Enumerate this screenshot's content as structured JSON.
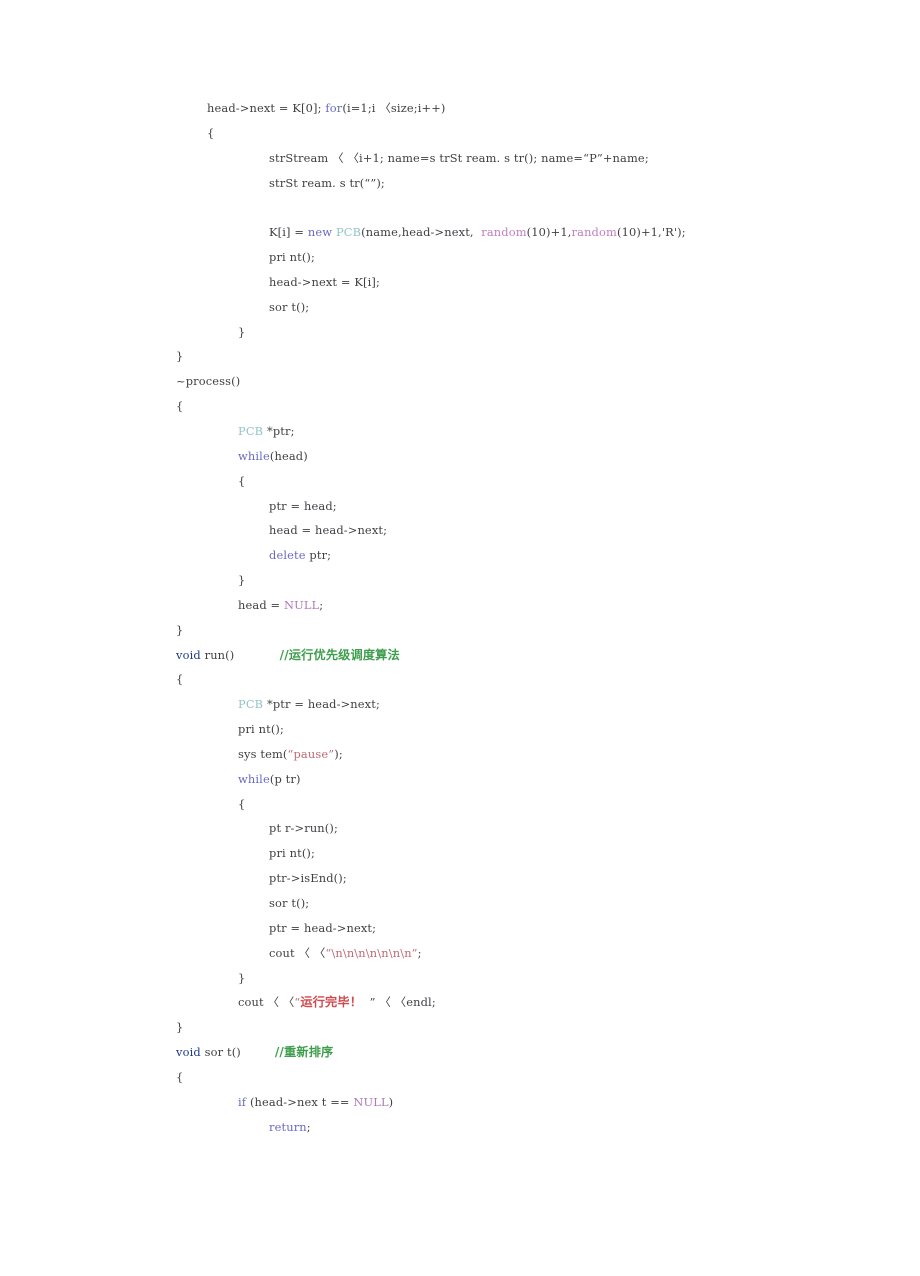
{
  "document": {
    "kind": "printed-source-code-page",
    "language": "C++",
    "background_color": "#ffffff",
    "default_text_color": "#3f3f44"
  },
  "colors": {
    "plain": "#3f3f44",
    "keyword": "#6a6ac4",
    "type": "#1e3a8a",
    "class_name": "#93c4c8",
    "function": "#c07ec0",
    "constant": "#b07ab8",
    "string": "#c06a74",
    "string_cn": "#d04a50",
    "comment": "#3f9e4d"
  },
  "code": {
    "lines": [
      {
        "indent": 0,
        "tokens": [
          {
            "t": "head->next = K[0]; ",
            "c": "plain"
          },
          {
            "t": "for",
            "c": "keyword"
          },
          {
            "t": "(i=1;i ",
            "c": "plain"
          },
          {
            "t": "〈",
            "c": "plain"
          },
          {
            "t": "size;i++)",
            "c": "plain"
          }
        ]
      },
      {
        "indent": 0,
        "tokens": [
          {
            "t": "{",
            "c": "plain"
          }
        ]
      },
      {
        "indent": 2,
        "tokens": [
          {
            "t": "strStream ",
            "c": "plain"
          },
          {
            "t": "〈 〈",
            "c": "plain"
          },
          {
            "t": "i+1; name=s trSt ream. s tr(); name=",
            "c": "plain"
          },
          {
            "t": "“P”",
            "c": "plain"
          },
          {
            "t": "+name;",
            "c": "plain"
          }
        ]
      },
      {
        "indent": 2,
        "tokens": [
          {
            "t": "strSt ream. s tr(",
            "c": "plain"
          },
          {
            "t": "“”",
            "c": "plain"
          },
          {
            "t": ");",
            "c": "plain"
          }
        ]
      },
      {
        "indent": 0,
        "tokens": []
      },
      {
        "indent": 2,
        "tokens": [
          {
            "t": "K[i] = ",
            "c": "plain"
          },
          {
            "t": "new",
            "c": "keyword"
          },
          {
            "t": " ",
            "c": "plain"
          },
          {
            "t": "PCB",
            "c": "class_name"
          },
          {
            "t": "(name,head->next,  ",
            "c": "plain"
          },
          {
            "t": "random",
            "c": "function"
          },
          {
            "t": "(10)+1,",
            "c": "plain"
          },
          {
            "t": "random",
            "c": "function"
          },
          {
            "t": "(10)+1,'R');",
            "c": "plain"
          }
        ]
      },
      {
        "indent": 2,
        "tokens": [
          {
            "t": "pri nt();",
            "c": "plain"
          }
        ]
      },
      {
        "indent": 2,
        "tokens": [
          {
            "t": "head->next = K[i];",
            "c": "plain"
          }
        ]
      },
      {
        "indent": 2,
        "tokens": [
          {
            "t": "sor t();",
            "c": "plain"
          }
        ]
      },
      {
        "indent": 1,
        "tokens": [
          {
            "t": "}",
            "c": "plain"
          }
        ]
      },
      {
        "indent": -1,
        "tokens": [
          {
            "t": "}",
            "c": "plain"
          }
        ]
      },
      {
        "indent": -1,
        "tokens": [
          {
            "t": "~process()",
            "c": "plain"
          }
        ]
      },
      {
        "indent": -1,
        "tokens": [
          {
            "t": "{",
            "c": "plain"
          }
        ]
      },
      {
        "indent": 1,
        "tokens": [
          {
            "t": "PCB",
            "c": "class_name"
          },
          {
            "t": " *ptr;",
            "c": "plain"
          }
        ]
      },
      {
        "indent": 1,
        "tokens": [
          {
            "t": "while",
            "c": "keyword"
          },
          {
            "t": "(head)",
            "c": "plain"
          }
        ]
      },
      {
        "indent": 1,
        "tokens": [
          {
            "t": "{",
            "c": "plain"
          }
        ]
      },
      {
        "indent": 2,
        "tokens": [
          {
            "t": "ptr = head;",
            "c": "plain"
          }
        ]
      },
      {
        "indent": 2,
        "tokens": [
          {
            "t": "head = head->next;",
            "c": "plain"
          }
        ]
      },
      {
        "indent": 2,
        "tokens": [
          {
            "t": "delete",
            "c": "keyword"
          },
          {
            "t": " ptr;",
            "c": "plain"
          }
        ]
      },
      {
        "indent": 1,
        "tokens": [
          {
            "t": "}",
            "c": "plain"
          }
        ]
      },
      {
        "indent": 1,
        "tokens": [
          {
            "t": "head = ",
            "c": "plain"
          },
          {
            "t": "NULL",
            "c": "constant"
          },
          {
            "t": ";",
            "c": "plain"
          }
        ]
      },
      {
        "indent": -1,
        "tokens": [
          {
            "t": "}",
            "c": "plain"
          }
        ]
      },
      {
        "indent": -1,
        "tokens": [
          {
            "t": "void",
            "c": "type"
          },
          {
            "t": " run()            ",
            "c": "plain"
          },
          {
            "t": "//运行优先级调度算法",
            "c": "comment",
            "cn": true
          }
        ]
      },
      {
        "indent": -1,
        "tokens": [
          {
            "t": "{",
            "c": "plain"
          }
        ]
      },
      {
        "indent": 1,
        "tokens": [
          {
            "t": "PCB",
            "c": "class_name"
          },
          {
            "t": " *ptr = head->next;",
            "c": "plain"
          }
        ]
      },
      {
        "indent": 1,
        "tokens": [
          {
            "t": "pri nt();",
            "c": "plain"
          }
        ]
      },
      {
        "indent": 1,
        "tokens": [
          {
            "t": "sys tem(",
            "c": "plain"
          },
          {
            "t": "“pause”",
            "c": "string"
          },
          {
            "t": ");",
            "c": "plain"
          }
        ]
      },
      {
        "indent": 1,
        "tokens": [
          {
            "t": "while",
            "c": "keyword"
          },
          {
            "t": "(p tr)",
            "c": "plain"
          }
        ]
      },
      {
        "indent": 1,
        "tokens": [
          {
            "t": "{",
            "c": "plain"
          }
        ]
      },
      {
        "indent": 2,
        "tokens": [
          {
            "t": "pt r->run();",
            "c": "plain"
          }
        ]
      },
      {
        "indent": 2,
        "tokens": [
          {
            "t": "pri nt();",
            "c": "plain"
          }
        ]
      },
      {
        "indent": 2,
        "tokens": [
          {
            "t": "ptr->isEnd();",
            "c": "plain"
          }
        ]
      },
      {
        "indent": 2,
        "tokens": [
          {
            "t": "sor t();",
            "c": "plain"
          }
        ]
      },
      {
        "indent": 2,
        "tokens": [
          {
            "t": "ptr = head->next;",
            "c": "plain"
          }
        ]
      },
      {
        "indent": 2,
        "tokens": [
          {
            "t": "cout ",
            "c": "plain"
          },
          {
            "t": "〈 〈",
            "c": "plain"
          },
          {
            "t": "“\\n\\n\\n\\n\\n\\n\\n”",
            "c": "string"
          },
          {
            "t": ";",
            "c": "plain"
          }
        ]
      },
      {
        "indent": 1,
        "tokens": [
          {
            "t": "}",
            "c": "plain"
          }
        ]
      },
      {
        "indent": 1,
        "tokens": [
          {
            "t": "cout ",
            "c": "plain"
          },
          {
            "t": "〈 〈",
            "c": "plain"
          },
          {
            "t": "“",
            "c": "string"
          },
          {
            "t": "运行完毕！",
            "c": "string_cn",
            "cn": true
          },
          {
            "t": "  ” ",
            "c": "plain"
          },
          {
            "t": "〈 〈",
            "c": "plain"
          },
          {
            "t": "endl;",
            "c": "plain"
          }
        ]
      },
      {
        "indent": -1,
        "tokens": [
          {
            "t": "}",
            "c": "plain"
          }
        ]
      },
      {
        "indent": -1,
        "tokens": [
          {
            "t": "void",
            "c": "type"
          },
          {
            "t": " sor t()         ",
            "c": "plain"
          },
          {
            "t": "//重新排序",
            "c": "comment",
            "cn": true
          }
        ]
      },
      {
        "indent": -1,
        "tokens": [
          {
            "t": "{",
            "c": "plain"
          }
        ]
      },
      {
        "indent": 1,
        "tokens": [
          {
            "t": "if",
            "c": "keyword"
          },
          {
            "t": " (head->nex t == ",
            "c": "plain"
          },
          {
            "t": "NULL",
            "c": "constant"
          },
          {
            "t": ")",
            "c": "plain"
          }
        ]
      },
      {
        "indent": 2,
        "tokens": [
          {
            "t": "return",
            "c": "keyword"
          },
          {
            "t": ";",
            "c": "plain"
          }
        ]
      }
    ]
  }
}
